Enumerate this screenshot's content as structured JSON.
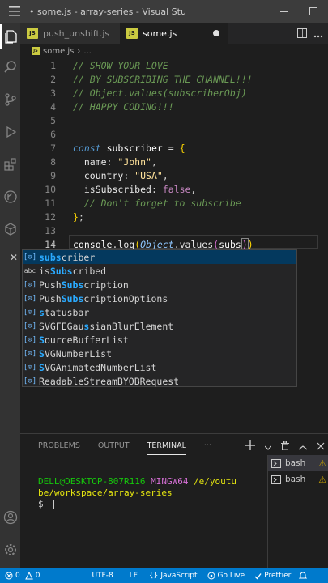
{
  "window": {
    "title": "• some.js - array-series - Visual Stu"
  },
  "tabs": [
    {
      "label": "push_unshift.js",
      "badge": "JS"
    },
    {
      "label": "some.js",
      "badge": "JS"
    }
  ],
  "breadcrumb": {
    "file": "some.js",
    "sep": "›",
    "more": "..."
  },
  "editor": {
    "lines": [
      {
        "n": "1",
        "parts": [
          [
            "cmt",
            "// SHOW YOUR LOVE"
          ]
        ]
      },
      {
        "n": "2",
        "parts": [
          [
            "cmt",
            "// BY SUBSCRIBING THE CHANNEL!!!"
          ]
        ]
      },
      {
        "n": "3",
        "parts": [
          [
            "cmt",
            "// Object.values(subscriberObj)"
          ]
        ]
      },
      {
        "n": "4",
        "parts": [
          [
            "cmt",
            "// HAPPY CODING!!!"
          ]
        ]
      },
      {
        "n": "5",
        "parts": []
      },
      {
        "n": "6",
        "parts": []
      },
      {
        "n": "7",
        "parts": [
          [
            "kw",
            "const"
          ],
          [
            "op",
            " "
          ],
          [
            "var",
            "subscriber"
          ],
          [
            "op",
            " = "
          ],
          [
            "brk1",
            "{"
          ]
        ]
      },
      {
        "n": "8",
        "parts": [
          [
            "prop",
            "  name"
          ],
          [
            "op",
            ": "
          ],
          [
            "str",
            "\"John\""
          ],
          [
            "op",
            ","
          ]
        ]
      },
      {
        "n": "9",
        "parts": [
          [
            "prop",
            "  country"
          ],
          [
            "op",
            ": "
          ],
          [
            "str",
            "\"USA\""
          ],
          [
            "op",
            ","
          ]
        ]
      },
      {
        "n": "10",
        "parts": [
          [
            "prop",
            "  isSubscribed"
          ],
          [
            "op",
            ": "
          ],
          [
            "bool",
            "false"
          ],
          [
            "op",
            ","
          ]
        ]
      },
      {
        "n": "11",
        "parts": [
          [
            "cmt",
            "  // Don't forget to subscribe"
          ]
        ]
      },
      {
        "n": "12",
        "parts": [
          [
            "brk1",
            "}"
          ],
          [
            "op",
            ";"
          ]
        ]
      },
      {
        "n": "13",
        "parts": []
      },
      {
        "n": "14",
        "parts": [
          [
            "var",
            "console"
          ],
          [
            "op",
            "."
          ],
          [
            "prop",
            "log"
          ],
          [
            "brk1",
            "("
          ],
          [
            "obj",
            "Object"
          ],
          [
            "op",
            "."
          ],
          [
            "prop",
            "values"
          ],
          [
            "brk2",
            "("
          ],
          [
            "var",
            "subs"
          ]
        ],
        "cursor": true,
        "after": [
          [
            "brk2",
            ")"
          ],
          [
            "brk1",
            ")"
          ]
        ]
      }
    ]
  },
  "suggest": {
    "items": [
      {
        "kind": "[⊙]",
        "pre": "",
        "match": "subs",
        "post": "criber",
        "selected": true
      },
      {
        "kind": "abc",
        "pre": "is",
        "match": "Subs",
        "post": "cribed"
      },
      {
        "kind": "[⊙]",
        "pre": "Push",
        "match": "Subs",
        "post": "cription"
      },
      {
        "kind": "[⊙]",
        "pre": "Push",
        "match": "Subs",
        "post": "criptionOptions"
      },
      {
        "kind": "[⊙]",
        "pre": "",
        "match": "s",
        "post": "tatusbar"
      },
      {
        "kind": "[⊙]",
        "pre": "SVGFEGau",
        "match": "s",
        "post": "sianBlurElement"
      },
      {
        "kind": "[⊙]",
        "pre": "",
        "match": "S",
        "post": "ourceBufferList"
      },
      {
        "kind": "[⊙]",
        "pre": "",
        "match": "S",
        "post": "VGNumberList"
      },
      {
        "kind": "[⊙]",
        "pre": "",
        "match": "S",
        "post": "VGAnimatedNumberList"
      },
      {
        "kind": "[⊙]",
        "pre": "ReadableStreamBYOBRequest",
        "match": "",
        "post": ""
      }
    ]
  },
  "panel": {
    "tabs": [
      "PROBLEMS",
      "OUTPUT",
      "TERMINAL",
      "···"
    ],
    "active_tab": "TERMINAL",
    "terminal": {
      "user": "DELL@DESKTOP-807R116",
      "env": "MINGW64",
      "path_line1": "/e/youtu",
      "path_line2": "be/workspace/array-series",
      "prompt": "$"
    },
    "terminals": [
      {
        "label": "bash",
        "warn": "⚠"
      },
      {
        "label": "bash",
        "warn": "⚠"
      }
    ]
  },
  "status": {
    "errors": "0",
    "warnings": "0",
    "encoding": "UTF-8",
    "eol": "LF",
    "language": "JavaScript",
    "golive": "Go Live",
    "prettier": "Prettier"
  }
}
